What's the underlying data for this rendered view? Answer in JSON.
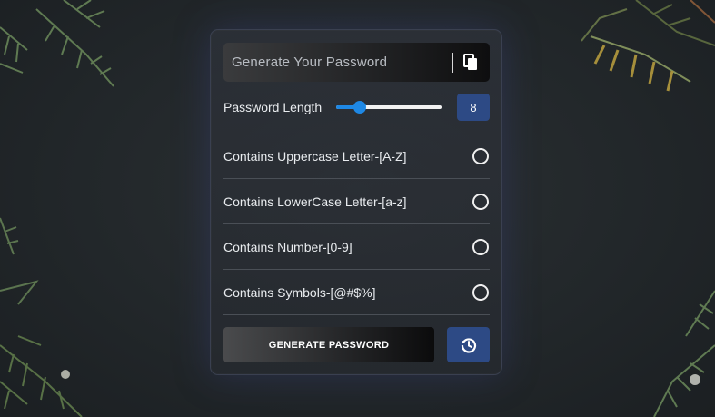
{
  "password_box": {
    "placeholder": "Generate Your Password",
    "copy_icon": "copy-icon"
  },
  "length": {
    "label": "Password Length",
    "value": "8",
    "slider_fraction": 0.22
  },
  "options": [
    {
      "label": "Contains Uppercase Letter-[A-Z]",
      "checked": false
    },
    {
      "label": "Contains LowerCase Letter-[a-z]",
      "checked": false
    },
    {
      "label": "Contains Number-[0-9]",
      "checked": false
    },
    {
      "label": "Contains Symbols-[@#$%]",
      "checked": false
    }
  ],
  "actions": {
    "generate_label": "GENERATE PASSWORD",
    "history_icon": "history-icon"
  },
  "colors": {
    "accent_blue": "#1e88e5",
    "button_blue": "#2d4a85",
    "card_border": "#3a4050"
  }
}
